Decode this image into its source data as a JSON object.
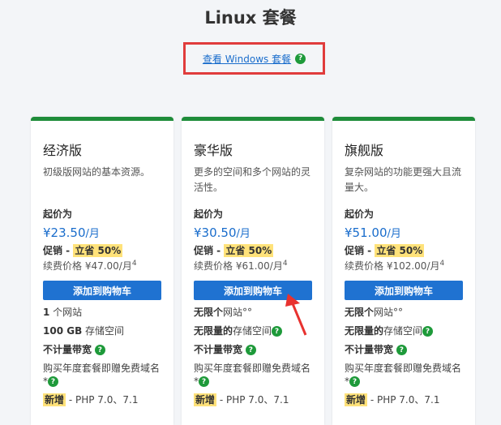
{
  "header": {
    "title": "Linux 套餐",
    "windows_link": "查看 Windows 套餐",
    "help": "?"
  },
  "plans": [
    {
      "name": "经济版",
      "desc": "初级版网站的基本资源。",
      "from": "起价为",
      "price": "¥23.50",
      "unit": "/月",
      "promo": "促销 - ",
      "promo_hl": "立省 50%",
      "renew": "续费价格 ¥47.00/月",
      "sup": "4",
      "button": "添加到购物车",
      "f1": "1",
      "f1b": " 个网站",
      "f2": "100 GB",
      "f2b": " 存储空间",
      "f3": "不计量带宽",
      "f4": "购买年度套餐即赠免费域名",
      "f4b": "*",
      "f5": "新增",
      "f5b": " - PHP 7.0、7.1"
    },
    {
      "name": "豪华版",
      "desc": "更多的空间和多个网站的灵活性。",
      "from": "起价为",
      "price": "¥30.50",
      "unit": "/月",
      "promo": "促销 - ",
      "promo_hl": "立省 50%",
      "renew": "续费价格 ¥61.00/月",
      "sup": "4",
      "button": "添加到购物车",
      "f1": "无限个",
      "f1b": "网站°°",
      "f2": "无限量的",
      "f2b": "存储空间",
      "f3": "不计量带宽",
      "f4": "购买年度套餐即赠免费域名",
      "f4b": "*",
      "f5": "新增",
      "f5b": " - PHP 7.0、7.1"
    },
    {
      "name": "旗舰版",
      "desc": "复杂网站的功能更强大且流量大。",
      "from": "起价为",
      "price": "¥51.00",
      "unit": "/月",
      "promo": "促销 - ",
      "promo_hl": "立省 50%",
      "renew": "续费价格 ¥102.00/月",
      "sup": "4",
      "button": "添加到购物车",
      "f1": "无限个",
      "f1b": "网站°°",
      "f2": "无限量的",
      "f2b": "存储空间",
      "f3": "不计量带宽",
      "f4": "购买年度套餐即赠免费域名",
      "f4b": "*",
      "f5": "新增",
      "f5b": " - PHP 7.0、7.1"
    }
  ]
}
